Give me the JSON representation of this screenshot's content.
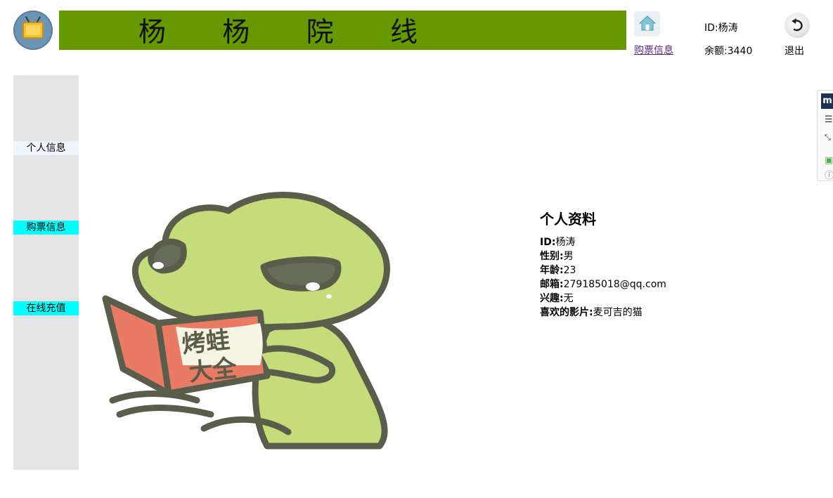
{
  "header": {
    "site_title": "杨 杨 院 线",
    "buy_link_label": "购票信息",
    "user_id_text": "ID:杨涛",
    "balance_text": "余额:3440",
    "exit_label": "退出"
  },
  "sidebar": {
    "items": [
      {
        "label": "个人信息"
      },
      {
        "label": "购票信息"
      },
      {
        "label": "在线充值"
      }
    ]
  },
  "profile": {
    "title": "个人资料",
    "rows": [
      {
        "label": "ID:",
        "value": "杨涛"
      },
      {
        "label": "性别:",
        "value": "男"
      },
      {
        "label": "年龄:",
        "value": "23"
      },
      {
        "label": "邮箱:",
        "value": "279185018@qq.com"
      },
      {
        "label": "兴趣:",
        "value": "无"
      },
      {
        "label": "喜欢的影片:",
        "value": "麦可吉的猫"
      }
    ]
  },
  "illustration": {
    "book_text_line1": "烤蛙",
    "book_text_line2": "大全"
  },
  "colors": {
    "banner": "#669900",
    "sidebar_bg": "#e4e4e4",
    "sidebar_active": "#eef6fd",
    "sidebar_highlight": "#00ffff",
    "frog_green": "#c5dc7a",
    "frog_outline": "#5a5d4a",
    "book_red": "#e97a63"
  },
  "icons": {
    "logo": "tv-icon",
    "home": "home-icon",
    "exit": "undo-arrow-icon"
  }
}
